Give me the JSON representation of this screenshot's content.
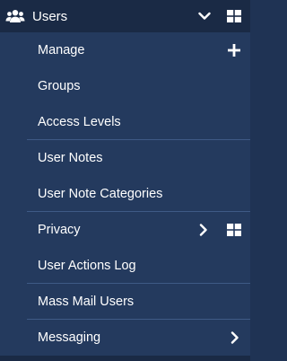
{
  "header": {
    "title": "Users",
    "icon": "users-icon",
    "expand_icon": "chevron-down-icon",
    "dashboard_icon": "grid-icon"
  },
  "items": [
    {
      "label": "Manage",
      "icon": "plus-icon"
    },
    {
      "label": "Groups"
    },
    {
      "label": "Access Levels"
    },
    {
      "label": "User Notes"
    },
    {
      "label": "User Note Categories"
    },
    {
      "label": "Privacy",
      "icons": [
        "chevron-right-icon",
        "grid-icon"
      ]
    },
    {
      "label": "User Actions Log"
    },
    {
      "label": "Mass Mail Users"
    },
    {
      "label": "Messaging",
      "icon": "chevron-right-icon"
    }
  ],
  "colors": {
    "header_bg": "#1a2a45",
    "submenu_bg": "#243a5e",
    "divider": "#3f5a86",
    "text": "#ffffff"
  }
}
